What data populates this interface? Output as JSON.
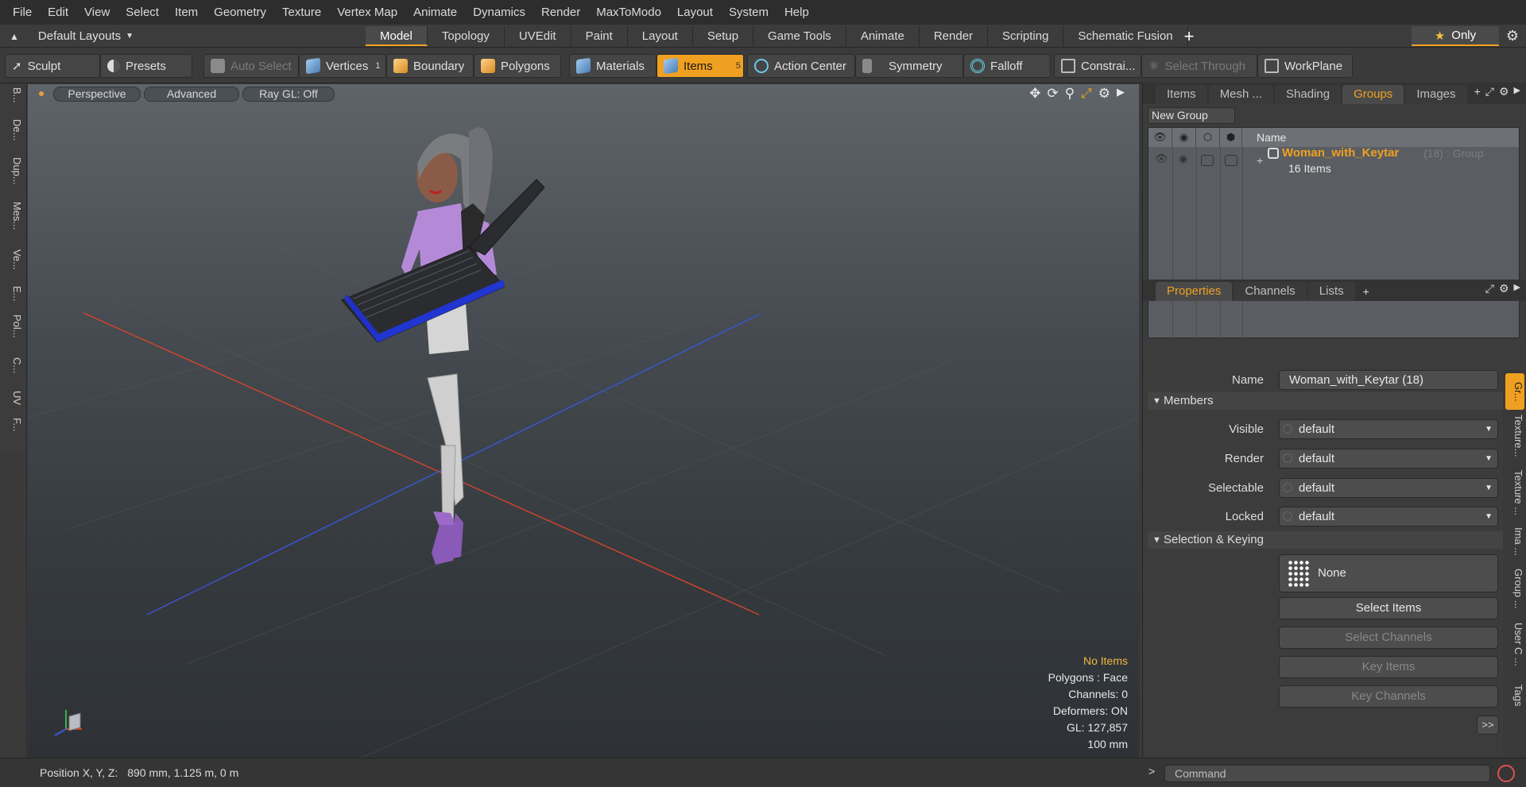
{
  "menu": [
    "File",
    "Edit",
    "View",
    "Select",
    "Item",
    "Geometry",
    "Texture",
    "Vertex Map",
    "Animate",
    "Dynamics",
    "Render",
    "MaxToModo",
    "Layout",
    "System",
    "Help"
  ],
  "layout_select": "Default Layouts",
  "layout_tabs": [
    "Model",
    "Topology",
    "UVEdit",
    "Paint",
    "Layout",
    "Setup",
    "Game Tools",
    "Animate",
    "Render",
    "Scripting",
    "Schematic Fusion"
  ],
  "active_layout_tab": "Model",
  "only_label": "Only",
  "toolbar": {
    "sculpt": "Sculpt",
    "presets": "Presets",
    "auto_select": "Auto Select",
    "vertices": "Vertices",
    "vertices_count": "1",
    "boundary": "Boundary",
    "polygons": "Polygons",
    "materials": "Materials",
    "items": "Items",
    "items_count": "5",
    "action_center": "Action Center",
    "symmetry": "Symmetry",
    "falloff": "Falloff",
    "constraints": "Constrai...",
    "select_through": "Select Through",
    "workplane": "WorkPlane"
  },
  "left_tabs": [
    "B...",
    "De...",
    "Dup...",
    "Mes...",
    "Ve...",
    "E...",
    "Pol...",
    "C...",
    "UV",
    "F..."
  ],
  "viewport": {
    "view_mode": "Perspective",
    "shading": "Advanced",
    "raygl": "Ray GL: Off",
    "stats": {
      "no_items": "No Items",
      "polygons": "Polygons : Face",
      "channels": "Channels: 0",
      "deformers": "Deformers: ON",
      "gl": "GL: 127,857",
      "grid": "100 mm"
    }
  },
  "groups_panel": {
    "tabs": [
      "Items",
      "Mesh ...",
      "Shading",
      "Groups",
      "Images"
    ],
    "active_tab": "Groups",
    "new_group": "New Group",
    "column_name": "Name",
    "group": {
      "name": "Woman_with_Keytar",
      "count_suffix": "(18) : Group",
      "items": "16 Items"
    }
  },
  "properties_panel": {
    "tabs": [
      "Properties",
      "Channels",
      "Lists"
    ],
    "active_tab": "Properties",
    "name_label": "Name",
    "name_value": "Woman_with_Keytar (18)",
    "members_header": "Members",
    "fields": [
      {
        "label": "Visible",
        "value": "default"
      },
      {
        "label": "Render",
        "value": "default"
      },
      {
        "label": "Selectable",
        "value": "default"
      },
      {
        "label": "Locked",
        "value": "default"
      }
    ],
    "keying_header": "Selection & Keying",
    "none_label": "None",
    "select_items": "Select Items",
    "select_channels": "Select Channels",
    "key_items": "Key Items",
    "key_channels": "Key Channels",
    "more": ">>",
    "side_tabs": [
      "Gr...",
      "Texture...",
      "Texture ...",
      "Ima ...",
      "Group ...",
      "User C ...",
      "Tags"
    ]
  },
  "status": {
    "position_label": "Position X, Y, Z:",
    "position_value": "890 mm, 1.125 m, 0 m"
  },
  "command_placeholder": "Command",
  "colors": {
    "accent": "#f0a020",
    "axis_x": "#d8432c",
    "axis_z": "#3c55d8"
  }
}
